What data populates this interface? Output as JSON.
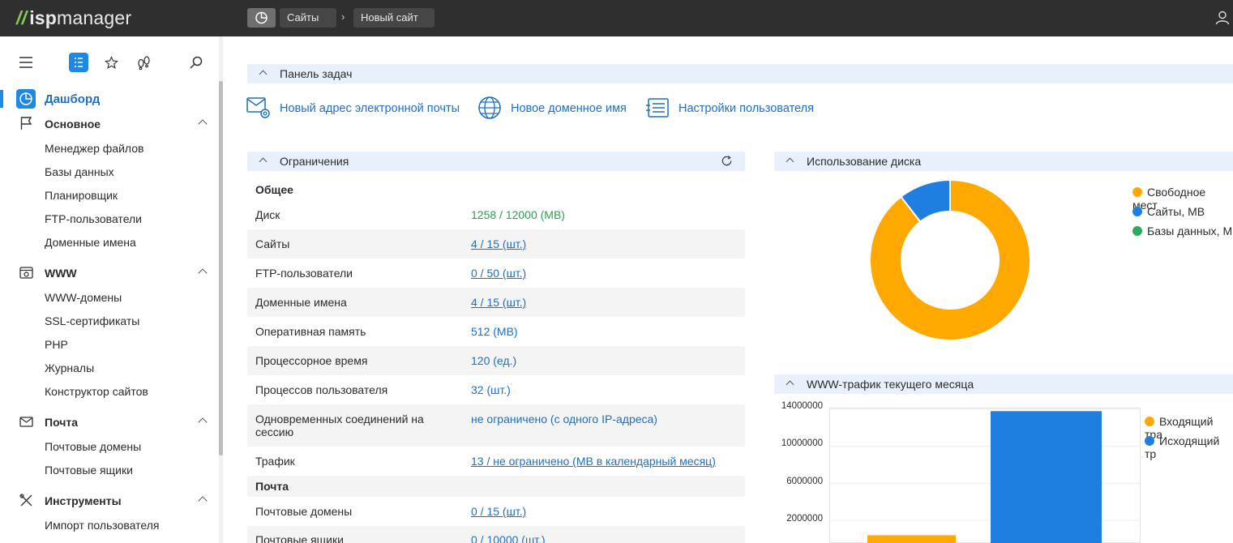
{
  "app": {
    "logo_mark": "//",
    "logo_isp": "isp",
    "logo_rest": "manager"
  },
  "breadcrumbs": [
    "Сайты",
    "Новый сайт"
  ],
  "breadcrumb_sep": "›",
  "sidebar": {
    "dashboard": "Дашборд",
    "sections": [
      {
        "title": "Основное",
        "items": [
          "Менеджер файлов",
          "Базы данных",
          "Планировщик",
          "FTP-пользователи",
          "Доменные имена"
        ]
      },
      {
        "title": "WWW",
        "items": [
          "WWW-домены",
          "SSL-сертификаты",
          "PHP",
          "Журналы",
          "Конструктор сайтов"
        ]
      },
      {
        "title": "Почта",
        "items": [
          "Почтовые домены",
          "Почтовые ящики"
        ]
      },
      {
        "title": "Инструменты",
        "items": [
          "Импорт пользователя"
        ]
      }
    ]
  },
  "tasks": {
    "title": "Панель задач",
    "items": [
      "Новый адрес электронной почты",
      "Новое доменное имя",
      "Настройки пользователя"
    ]
  },
  "limits": {
    "title": "Ограничения",
    "group_general": "Общее",
    "group_mail": "Почта",
    "rows": [
      {
        "label": "Диск",
        "value": "1258 / 12000 (MB)"
      },
      {
        "label": "Сайты",
        "value": "4 / 15 (шт.)"
      },
      {
        "label": "FTP-пользователи",
        "value": "0 / 50 (шт.)"
      },
      {
        "label": "Доменные имена",
        "value": "4 / 15 (шт.)"
      },
      {
        "label": "Оперативная память",
        "value": "512 (MB)"
      },
      {
        "label": "Процессорное время",
        "value": "120 (ед.)"
      },
      {
        "label": "Процессов пользователя",
        "value": "32 (шт.)"
      },
      {
        "label": "Одновременных соединений на",
        "label2": "сессию",
        "value": "не ограничено (с одного IP-адреса)"
      },
      {
        "label": "Трафик",
        "value": "13 / не ограничено (MB в календарный месяц)"
      },
      {
        "label": "Почтовые домены",
        "value": "0 / 15 (шт.)"
      },
      {
        "label": "Почтовые ящики",
        "value": "0 / 10000 (шт.)"
      }
    ]
  },
  "disk": {
    "title": "Использование диска",
    "legend": [
      "Свободное мест",
      "Сайты, MB",
      "Базы данных, M"
    ]
  },
  "traffic": {
    "title": "WWW-трафик текущего месяца",
    "legend": [
      "Входящий тра",
      "Исходящий тр"
    ]
  },
  "colors": {
    "accent": "#1e88e5",
    "orange": "#ffa800",
    "blue": "#1e7fe0",
    "green": "#2eaa5f",
    "link": "#1e6fc0"
  },
  "chart_data": [
    {
      "type": "pie",
      "title": "Использование диска",
      "categories": [
        "Свободное мест",
        "Сайты, MB",
        "Базы данных, M"
      ],
      "values": [
        10742,
        1258,
        0
      ]
    },
    {
      "type": "bar",
      "title": "WWW-трафик текущего месяца",
      "categories": [
        "",
        ""
      ],
      "series": [
        {
          "name": "Входящий тра",
          "values": [
            400000,
            0
          ]
        },
        {
          "name": "Исходящий тр",
          "values": [
            0,
            13800000
          ]
        }
      ],
      "yticks": [
        "2000000",
        "6000000",
        "10000000",
        "14000000"
      ],
      "ylim": [
        0,
        15000000
      ]
    }
  ]
}
